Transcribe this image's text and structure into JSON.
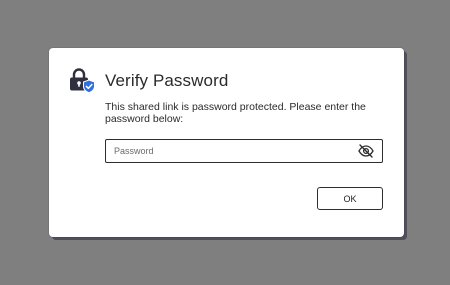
{
  "dialog": {
    "title": "Verify Password",
    "title_icon": "lock-with-shield-icon",
    "message": "This shared link is password protected. Please enter the password below:",
    "password_field": {
      "placeholder": "Password",
      "value": "",
      "toggle_icon": "eye-slash-icon"
    },
    "ok_label": "OK"
  },
  "colors": {
    "backdrop": "#7f7f7f",
    "dialog_bg": "#ffffff",
    "lock_body": "#2f2f3f",
    "shield": "#2f6fe0"
  }
}
